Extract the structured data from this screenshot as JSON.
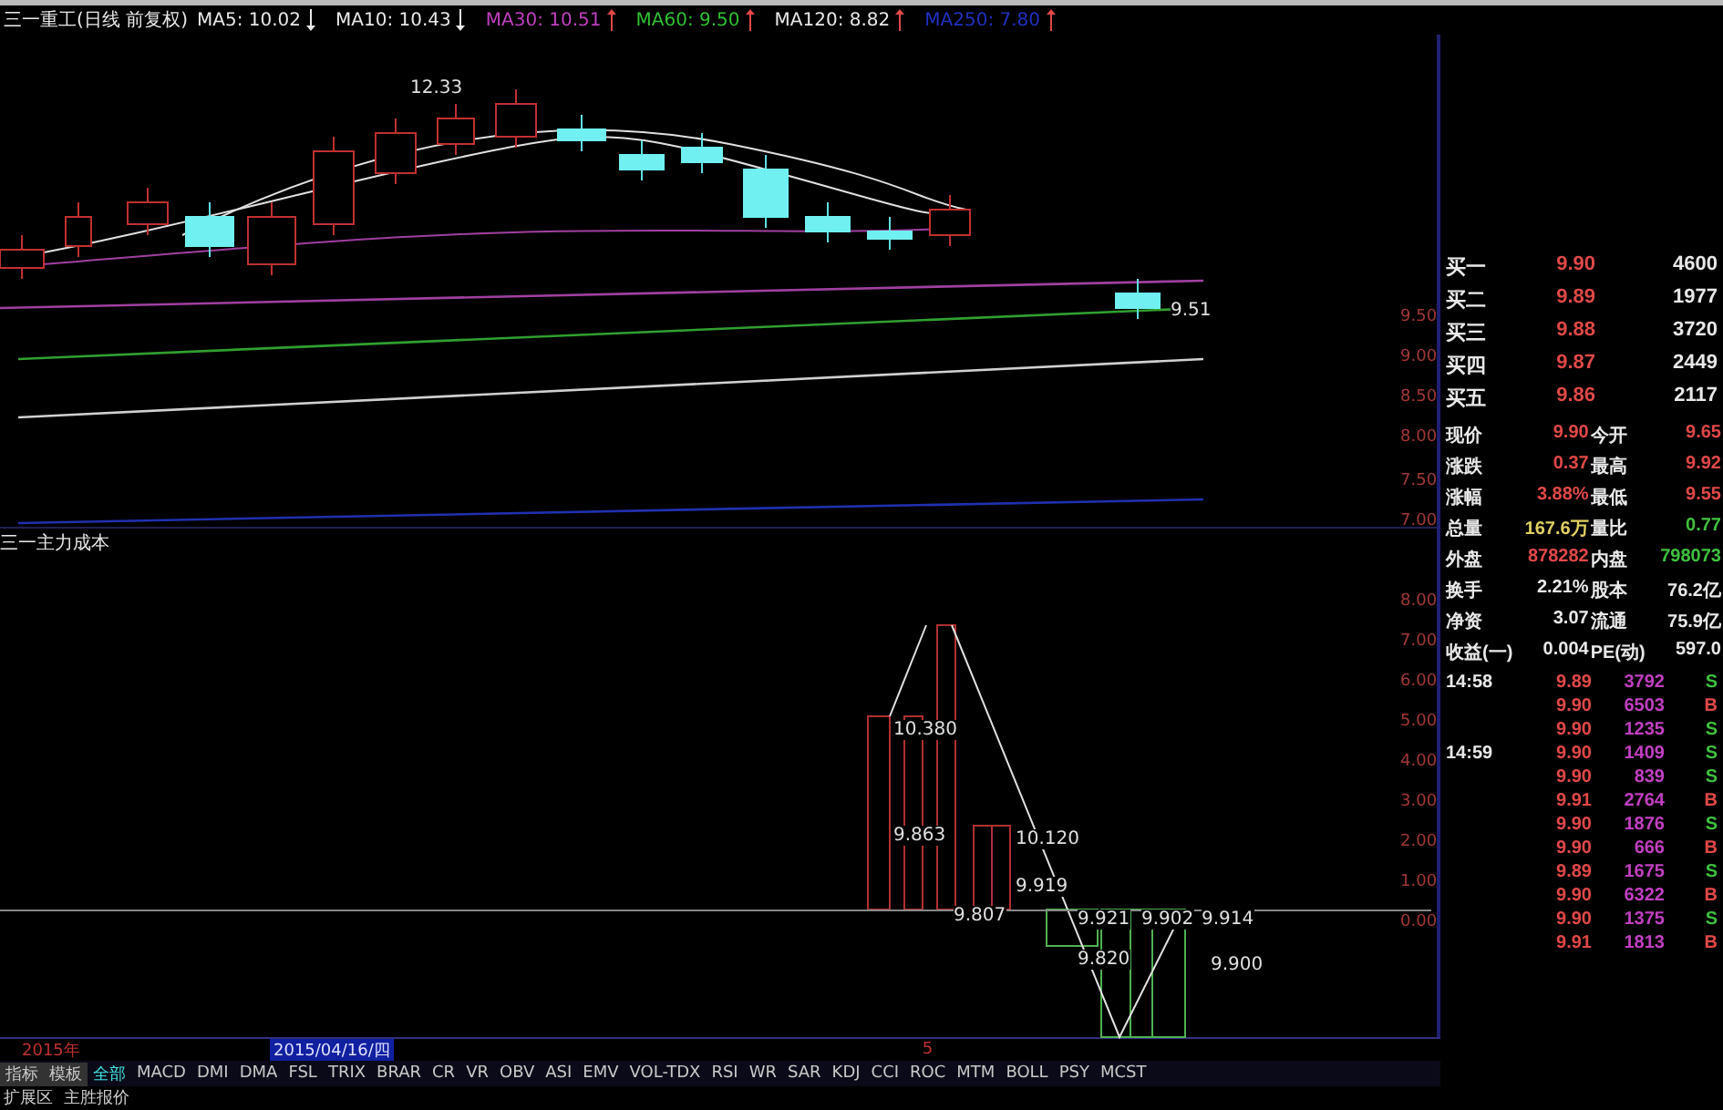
{
  "header": {
    "title": "三一重工(日线 前复权)",
    "ma": [
      {
        "label": "MA5: 10.02",
        "color": "#e8e8e8",
        "rising": false
      },
      {
        "label": "MA10: 10.43",
        "color": "#e8e8e8",
        "rising": false
      },
      {
        "label": "MA30: 10.51",
        "color": "#c040c0",
        "rising": true
      },
      {
        "label": "MA60: 9.50",
        "color": "#30c030",
        "rising": true
      },
      {
        "label": "MA120: 8.82",
        "color": "#e8e8e8",
        "rising": true
      },
      {
        "label": "MA250: 7.80",
        "color": "#2030c0",
        "rising": true
      }
    ]
  },
  "price_chart": {
    "labels": [
      "12.33",
      "9.51"
    ],
    "axis": [
      "9.50",
      "9.00",
      "8.50",
      "8.00",
      "7.50",
      "7.00"
    ]
  },
  "indicator": {
    "title": "三一主力成本",
    "labels": [
      "10.380",
      "9.863",
      "9.807",
      "10.120",
      "9.919",
      "9.921",
      "9.820",
      "9.902",
      "9.914",
      "9.900"
    ],
    "axis": [
      "8.00",
      "7.00",
      "6.00",
      "5.00",
      "4.00",
      "3.00",
      "2.00",
      "1.00",
      "0.00"
    ]
  },
  "quotes": {
    "bids": [
      {
        "label": "买一",
        "price": "9.90",
        "volume": "4600"
      },
      {
        "label": "买二",
        "price": "9.89",
        "volume": "1977"
      },
      {
        "label": "买三",
        "price": "9.88",
        "volume": "3720"
      },
      {
        "label": "买四",
        "price": "9.87",
        "volume": "2449"
      },
      {
        "label": "买五",
        "price": "9.86",
        "volume": "2117"
      }
    ],
    "stats": [
      [
        {
          "label": "现价",
          "value": "9.90",
          "color": "#e04848"
        },
        {
          "label": "今开",
          "value": "9.65",
          "color": "#e04848"
        }
      ],
      [
        {
          "label": "涨跌",
          "value": "0.37",
          "color": "#e04848"
        },
        {
          "label": "最高",
          "value": "9.92",
          "color": "#e04848"
        }
      ],
      [
        {
          "label": "涨幅",
          "value": "3.88%",
          "color": "#e04848"
        },
        {
          "label": "最低",
          "value": "9.55",
          "color": "#e04848"
        }
      ],
      [
        {
          "label": "总量",
          "value": "167.6万",
          "color": "#e0d060"
        },
        {
          "label": "量比",
          "value": "0.77",
          "color": "#40c040"
        }
      ],
      [
        {
          "label": "外盘",
          "value": "878282",
          "color": "#e04848"
        },
        {
          "label": "内盘",
          "value": "798073",
          "color": "#40c040"
        }
      ],
      [
        {
          "label": "换手",
          "value": "2.21%",
          "color": "#e8e8e8"
        },
        {
          "label": "股本",
          "value": "76.2亿",
          "color": "#e8e8e8"
        }
      ],
      [
        {
          "label": "净资",
          "value": "3.07",
          "color": "#e8e8e8"
        },
        {
          "label": "流通",
          "value": "75.9亿",
          "color": "#e8e8e8"
        }
      ],
      [
        {
          "label": "收益(一)",
          "value": "0.004",
          "color": "#e8e8e8"
        },
        {
          "label": "PE(动)",
          "value": "597.0",
          "color": "#e8e8e8"
        }
      ]
    ],
    "trades": [
      {
        "time": "14:58",
        "price": "9.89",
        "volume": "3792",
        "flag": "S",
        "sell": true
      },
      {
        "price": "9.90",
        "volume": "6503",
        "flag": "B",
        "sell": false
      },
      {
        "price": "9.90",
        "volume": "1235",
        "flag": "S",
        "sell": true
      },
      {
        "time": "14:59",
        "price": "9.90",
        "volume": "1409",
        "flag": "S",
        "sell": true
      },
      {
        "price": "9.90",
        "volume": "839",
        "flag": "S",
        "sell": true
      },
      {
        "price": "9.91",
        "volume": "2764",
        "flag": "B",
        "sell": false
      },
      {
        "price": "9.90",
        "volume": "1876",
        "flag": "S",
        "sell": true
      },
      {
        "price": "9.90",
        "volume": "666",
        "flag": "B",
        "sell": false
      },
      {
        "price": "9.89",
        "volume": "1675",
        "flag": "S",
        "sell": true
      },
      {
        "price": "9.90",
        "volume": "6322",
        "flag": "B",
        "sell": false
      },
      {
        "price": "9.90",
        "volume": "1375",
        "flag": "S",
        "sell": true
      },
      {
        "price": "9.91",
        "volume": "1813",
        "flag": "B",
        "sell": false
      }
    ]
  },
  "date_bar": {
    "year": "2015年",
    "date": "2015/04/16/四",
    "mark": "5"
  },
  "toolbar": [
    {
      "label": "指标",
      "selected": false,
      "kind": "tab"
    },
    {
      "label": "模板",
      "selected": false,
      "kind": "tab"
    },
    {
      "label": "全部",
      "selected": true,
      "kind": "item"
    },
    {
      "label": "MACD",
      "selected": false,
      "kind": "item"
    },
    {
      "label": "DMI",
      "selected": false,
      "kind": "item"
    },
    {
      "label": "DMA",
      "selected": false,
      "kind": "item"
    },
    {
      "label": "FSL",
      "selected": false,
      "kind": "item"
    },
    {
      "label": "TRIX",
      "selected": false,
      "kind": "item"
    },
    {
      "label": "BRAR",
      "selected": false,
      "kind": "item"
    },
    {
      "label": "CR",
      "selected": false,
      "kind": "item"
    },
    {
      "label": "VR",
      "selected": false,
      "kind": "item"
    },
    {
      "label": "OBV",
      "selected": false,
      "kind": "item"
    },
    {
      "label": "ASI",
      "selected": false,
      "kind": "item"
    },
    {
      "label": "EMV",
      "selected": false,
      "kind": "item"
    },
    {
      "label": "VOL-TDX",
      "selected": false,
      "kind": "item"
    },
    {
      "label": "RSI",
      "selected": false,
      "kind": "item"
    },
    {
      "label": "WR",
      "selected": false,
      "kind": "item"
    },
    {
      "label": "SAR",
      "selected": false,
      "kind": "item"
    },
    {
      "label": "KDJ",
      "selected": false,
      "kind": "item"
    },
    {
      "label": "CCI",
      "selected": false,
      "kind": "item"
    },
    {
      "label": "ROC",
      "selected": false,
      "kind": "item"
    },
    {
      "label": "MTM",
      "selected": false,
      "kind": "item"
    },
    {
      "label": "BOLL",
      "selected": false,
      "kind": "item"
    },
    {
      "label": "PSY",
      "selected": false,
      "kind": "item"
    },
    {
      "label": "MCST",
      "selected": false,
      "kind": "item"
    }
  ],
  "status_bar": [
    "扩展区",
    "主胜报价"
  ]
}
